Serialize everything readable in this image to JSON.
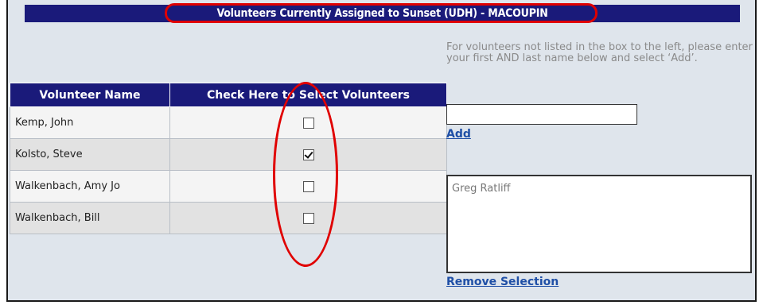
{
  "header": {
    "title": "Volunteers Currently Assigned to Sunset (UDH) - MACOUPIN"
  },
  "table": {
    "columns": [
      "Volunteer Name",
      "Check Here to Select Volunteers"
    ],
    "rows": [
      {
        "name": "Kemp, John",
        "checked": false
      },
      {
        "name": "Kolsto, Steve",
        "checked": true
      },
      {
        "name": "Walkenbach, Amy Jo",
        "checked": false
      },
      {
        "name": "Walkenbach, Bill",
        "checked": false
      }
    ]
  },
  "add_panel": {
    "instructions": "For volunteers not listed in the box to the left, please enter your first AND last name below and select ‘Add’.",
    "input_value": "",
    "add_label": "Add"
  },
  "selection_panel": {
    "items": [
      "Greg Ratliff"
    ],
    "remove_label": "Remove Selection"
  },
  "colors": {
    "header_bg": "#1a1a7a",
    "annotation": "#e00000",
    "link": "#1f4fa6",
    "panel_bg": "#dfe5ec"
  }
}
